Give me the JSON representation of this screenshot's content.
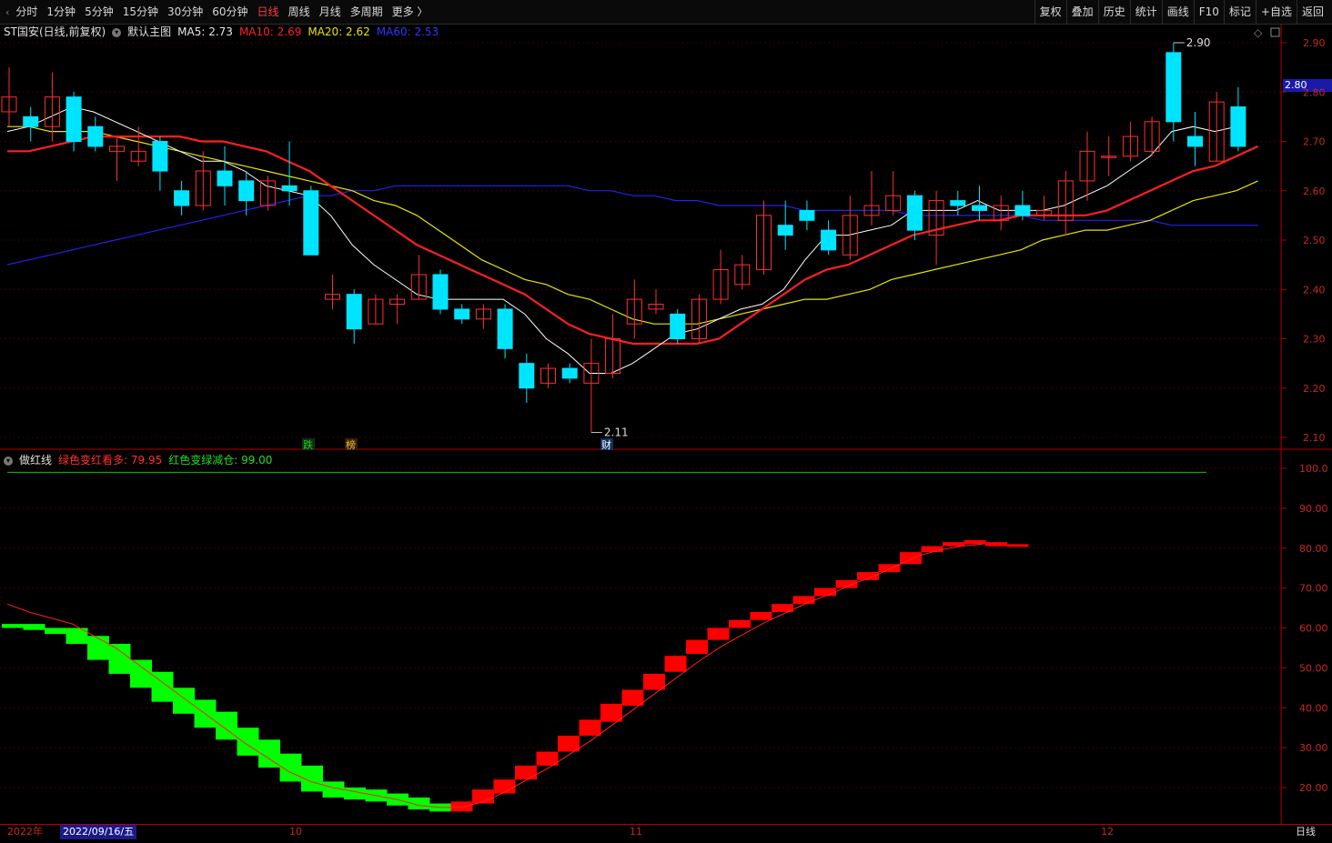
{
  "toolbar": {
    "back_icon": "‹",
    "periods": [
      "分时",
      "1分钟",
      "5分钟",
      "15分钟",
      "30分钟",
      "60分钟",
      "日线",
      "周线",
      "月线",
      "多周期",
      "更多 〉"
    ],
    "active_period": "日线",
    "tools": [
      "复权",
      "叠加",
      "历史",
      "统计",
      "画线",
      "F10",
      "标记",
      "+自选",
      "返回"
    ]
  },
  "main_panel": {
    "title": "ST国安(日线,前复权)",
    "template": "默认主图",
    "ma5": "MA5: 2.73",
    "ma10": "MA10: 2.69",
    "ma20": "MA20: 2.62",
    "ma60": "MA60: 2.53",
    "high_label": "2.90",
    "low_label": "2.11",
    "current_price": "2.80",
    "markers": [
      "跌",
      "榜",
      "财"
    ],
    "price_ticks": [
      "2.90",
      "2.80",
      "2.70",
      "2.60",
      "2.50",
      "2.40",
      "2.30",
      "2.20",
      "2.10"
    ]
  },
  "sub_panel": {
    "title": "做红线",
    "label_a": "绿色变红看多: 79.95",
    "label_b": "红色变绿减仓: 99.00",
    "ticks": [
      "100.0",
      "90.00",
      "80.00",
      "70.00",
      "60.00",
      "50.00",
      "40.00",
      "30.00",
      "20.00"
    ]
  },
  "time_axis": {
    "year": "2022年",
    "cursor_date": "2022/09/16/五",
    "months": [
      "10",
      "11",
      "12"
    ],
    "period": "日线"
  },
  "colors": {
    "up": "#ff3030",
    "down": "#00e5ff",
    "ma5": "#ffffff",
    "ma10": "#ff2020",
    "ma20": "#e6e600",
    "ma60": "#2222ee",
    "osc_red": "#ff0000",
    "osc_green": "#00ff00"
  },
  "chart_data": {
    "type": "candlestick",
    "candles": [
      {
        "o": 2.76,
        "c": 2.79,
        "h": 2.85,
        "l": 2.73
      },
      {
        "o": 2.75,
        "c": 2.73,
        "h": 2.77,
        "l": 2.7
      },
      {
        "o": 2.73,
        "c": 2.79,
        "h": 2.84,
        "l": 2.7
      },
      {
        "o": 2.79,
        "c": 2.7,
        "h": 2.8,
        "l": 2.68
      },
      {
        "o": 2.73,
        "c": 2.69,
        "h": 2.75,
        "l": 2.68
      },
      {
        "o": 2.68,
        "c": 2.69,
        "h": 2.71,
        "l": 2.62
      },
      {
        "o": 2.66,
        "c": 2.68,
        "h": 2.73,
        "l": 2.65
      },
      {
        "o": 2.7,
        "c": 2.64,
        "h": 2.71,
        "l": 2.6
      },
      {
        "o": 2.6,
        "c": 2.57,
        "h": 2.62,
        "l": 2.55
      },
      {
        "o": 2.57,
        "c": 2.64,
        "h": 2.68,
        "l": 2.56
      },
      {
        "o": 2.64,
        "c": 2.61,
        "h": 2.69,
        "l": 2.57
      },
      {
        "o": 2.62,
        "c": 2.58,
        "h": 2.64,
        "l": 2.55
      },
      {
        "o": 2.57,
        "c": 2.62,
        "h": 2.63,
        "l": 2.56
      },
      {
        "o": 2.61,
        "c": 2.6,
        "h": 2.7,
        "l": 2.57
      },
      {
        "o": 2.6,
        "c": 2.47,
        "h": 2.61,
        "l": 2.47
      },
      {
        "o": 2.38,
        "c": 2.39,
        "h": 2.43,
        "l": 2.36
      },
      {
        "o": 2.39,
        "c": 2.32,
        "h": 2.4,
        "l": 2.29
      },
      {
        "o": 2.33,
        "c": 2.38,
        "h": 2.39,
        "l": 2.33
      },
      {
        "o": 2.37,
        "c": 2.38,
        "h": 2.39,
        "l": 2.33
      },
      {
        "o": 2.38,
        "c": 2.43,
        "h": 2.47,
        "l": 2.38
      },
      {
        "o": 2.43,
        "c": 2.36,
        "h": 2.44,
        "l": 2.35
      },
      {
        "o": 2.36,
        "c": 2.34,
        "h": 2.37,
        "l": 2.33
      },
      {
        "o": 2.34,
        "c": 2.36,
        "h": 2.37,
        "l": 2.32
      },
      {
        "o": 2.36,
        "c": 2.28,
        "h": 2.37,
        "l": 2.26
      },
      {
        "o": 2.25,
        "c": 2.2,
        "h": 2.27,
        "l": 2.17
      },
      {
        "o": 2.21,
        "c": 2.24,
        "h": 2.25,
        "l": 2.2
      },
      {
        "o": 2.24,
        "c": 2.22,
        "h": 2.25,
        "l": 2.21
      },
      {
        "o": 2.21,
        "c": 2.25,
        "h": 2.3,
        "l": 2.11
      },
      {
        "o": 2.23,
        "c": 2.3,
        "h": 2.35,
        "l": 2.22
      },
      {
        "o": 2.33,
        "c": 2.38,
        "h": 2.42,
        "l": 2.3
      },
      {
        "o": 2.36,
        "c": 2.37,
        "h": 2.4,
        "l": 2.35
      },
      {
        "o": 2.35,
        "c": 2.3,
        "h": 2.36,
        "l": 2.29
      },
      {
        "o": 2.3,
        "c": 2.38,
        "h": 2.39,
        "l": 2.29
      },
      {
        "o": 2.38,
        "c": 2.44,
        "h": 2.48,
        "l": 2.37
      },
      {
        "o": 2.41,
        "c": 2.45,
        "h": 2.47,
        "l": 2.4
      },
      {
        "o": 2.44,
        "c": 2.55,
        "h": 2.58,
        "l": 2.43
      },
      {
        "o": 2.53,
        "c": 2.51,
        "h": 2.58,
        "l": 2.48
      },
      {
        "o": 2.56,
        "c": 2.54,
        "h": 2.58,
        "l": 2.52
      },
      {
        "o": 2.52,
        "c": 2.48,
        "h": 2.54,
        "l": 2.47
      },
      {
        "o": 2.47,
        "c": 2.55,
        "h": 2.59,
        "l": 2.46
      },
      {
        "o": 2.55,
        "c": 2.57,
        "h": 2.64,
        "l": 2.53
      },
      {
        "o": 2.56,
        "c": 2.59,
        "h": 2.64,
        "l": 2.55
      },
      {
        "o": 2.59,
        "c": 2.52,
        "h": 2.6,
        "l": 2.5
      },
      {
        "o": 2.51,
        "c": 2.58,
        "h": 2.6,
        "l": 2.45
      },
      {
        "o": 2.58,
        "c": 2.57,
        "h": 2.6,
        "l": 2.55
      },
      {
        "o": 2.57,
        "c": 2.56,
        "h": 2.61,
        "l": 2.54
      },
      {
        "o": 2.54,
        "c": 2.57,
        "h": 2.59,
        "l": 2.52
      },
      {
        "o": 2.57,
        "c": 2.55,
        "h": 2.6,
        "l": 2.54
      },
      {
        "o": 2.55,
        "c": 2.56,
        "h": 2.59,
        "l": 2.54
      },
      {
        "o": 2.54,
        "c": 2.62,
        "h": 2.64,
        "l": 2.51
      },
      {
        "o": 2.62,
        "c": 2.68,
        "h": 2.72,
        "l": 2.58
      },
      {
        "o": 2.67,
        "c": 2.67,
        "h": 2.71,
        "l": 2.63
      },
      {
        "o": 2.67,
        "c": 2.71,
        "h": 2.74,
        "l": 2.66
      },
      {
        "o": 2.68,
        "c": 2.74,
        "h": 2.75,
        "l": 2.67
      },
      {
        "o": 2.88,
        "c": 2.74,
        "h": 2.9,
        "l": 2.7
      },
      {
        "o": 2.71,
        "c": 2.69,
        "h": 2.76,
        "l": 2.65
      },
      {
        "o": 2.66,
        "c": 2.78,
        "h": 2.8,
        "l": 2.66
      },
      {
        "o": 2.77,
        "c": 2.69,
        "h": 2.81,
        "l": 2.68
      }
    ],
    "ma5": [
      2.72,
      2.73,
      2.75,
      2.77,
      2.76,
      2.74,
      2.72,
      2.7,
      2.68,
      2.66,
      2.66,
      2.64,
      2.61,
      2.6,
      2.59,
      2.55,
      2.49,
      2.45,
      2.42,
      2.39,
      2.38,
      2.38,
      2.38,
      2.38,
      2.35,
      2.3,
      2.27,
      2.23,
      2.23,
      2.25,
      2.28,
      2.31,
      2.32,
      2.34,
      2.36,
      2.37,
      2.4,
      2.46,
      2.51,
      2.51,
      2.52,
      2.53,
      2.56,
      2.56,
      2.56,
      2.58,
      2.56,
      2.56,
      2.56,
      2.57,
      2.59,
      2.61,
      2.64,
      2.67,
      2.72,
      2.73,
      2.72,
      2.73
    ],
    "ma10": [
      2.68,
      2.68,
      2.69,
      2.7,
      2.71,
      2.71,
      2.71,
      2.71,
      2.71,
      2.7,
      2.7,
      2.69,
      2.68,
      2.66,
      2.64,
      2.61,
      2.58,
      2.55,
      2.52,
      2.49,
      2.47,
      2.45,
      2.43,
      2.41,
      2.39,
      2.36,
      2.33,
      2.31,
      2.3,
      2.29,
      2.29,
      2.29,
      2.29,
      2.3,
      2.33,
      2.36,
      2.39,
      2.42,
      2.44,
      2.45,
      2.47,
      2.49,
      2.51,
      2.52,
      2.53,
      2.54,
      2.54,
      2.55,
      2.55,
      2.55,
      2.55,
      2.56,
      2.58,
      2.6,
      2.62,
      2.64,
      2.65,
      2.67,
      2.69
    ],
    "ma20": [
      2.73,
      2.73,
      2.72,
      2.72,
      2.72,
      2.71,
      2.7,
      2.69,
      2.68,
      2.67,
      2.66,
      2.65,
      2.64,
      2.63,
      2.62,
      2.61,
      2.6,
      2.58,
      2.57,
      2.55,
      2.52,
      2.49,
      2.46,
      2.44,
      2.42,
      2.41,
      2.39,
      2.38,
      2.36,
      2.34,
      2.33,
      2.33,
      2.33,
      2.34,
      2.35,
      2.36,
      2.37,
      2.38,
      2.38,
      2.39,
      2.4,
      2.42,
      2.43,
      2.44,
      2.45,
      2.46,
      2.47,
      2.48,
      2.5,
      2.51,
      2.52,
      2.52,
      2.53,
      2.54,
      2.56,
      2.58,
      2.59,
      2.6,
      2.62
    ],
    "ma60": [
      2.45,
      2.46,
      2.47,
      2.48,
      2.49,
      2.5,
      2.51,
      2.52,
      2.53,
      2.54,
      2.55,
      2.56,
      2.57,
      2.58,
      2.59,
      2.59,
      2.6,
      2.6,
      2.61,
      2.61,
      2.61,
      2.61,
      2.61,
      2.61,
      2.61,
      2.61,
      2.61,
      2.6,
      2.6,
      2.59,
      2.59,
      2.58,
      2.58,
      2.57,
      2.57,
      2.57,
      2.57,
      2.56,
      2.56,
      2.56,
      2.56,
      2.56,
      2.55,
      2.55,
      2.55,
      2.55,
      2.55,
      2.55,
      2.54,
      2.54,
      2.54,
      2.54,
      2.54,
      2.54,
      2.53,
      2.53,
      2.53,
      2.53,
      2.53
    ],
    "oscillator": {
      "ylim": [
        14,
        104
      ],
      "block_lower": [
        60,
        59.5,
        58.5,
        56,
        52,
        48.5,
        45,
        41.5,
        38.5,
        35,
        32,
        28,
        25,
        21.5,
        19,
        17.5,
        17,
        16.5,
        15.5,
        14.5,
        14,
        14,
        16,
        18.5,
        22,
        25.5,
        29,
        33,
        36.5,
        40.5,
        44.5,
        49,
        53.5,
        57,
        60,
        62,
        64,
        66,
        68,
        70,
        72,
        74,
        76,
        79,
        80.5,
        81,
        80.5,
        80.5
      ],
      "block_upper": [
        61,
        61,
        60,
        60,
        58,
        56,
        52,
        49,
        45,
        42,
        39,
        35,
        32,
        28.5,
        25.5,
        21.5,
        20,
        19.5,
        18.5,
        17.5,
        16,
        16.5,
        19.5,
        22,
        25.5,
        29,
        33,
        37,
        41,
        44.5,
        48.5,
        53,
        57,
        60,
        62,
        64,
        66,
        68,
        70,
        72,
        74,
        76,
        79,
        80.5,
        81.5,
        82,
        81.5,
        81
      ],
      "signal": [
        66,
        64,
        62.5,
        61,
        58,
        55,
        51,
        47,
        43,
        39,
        35,
        31,
        27.5,
        24,
        21.5,
        20,
        19,
        18,
        17,
        15.5,
        15,
        15,
        16.5,
        19,
        22,
        25,
        28.5,
        32,
        36,
        40,
        44,
        48,
        52,
        55.5,
        58.5,
        61.5,
        64,
        66.5,
        68.5,
        71,
        73,
        75.5,
        78,
        79.5,
        80.5,
        81
      ]
    }
  }
}
